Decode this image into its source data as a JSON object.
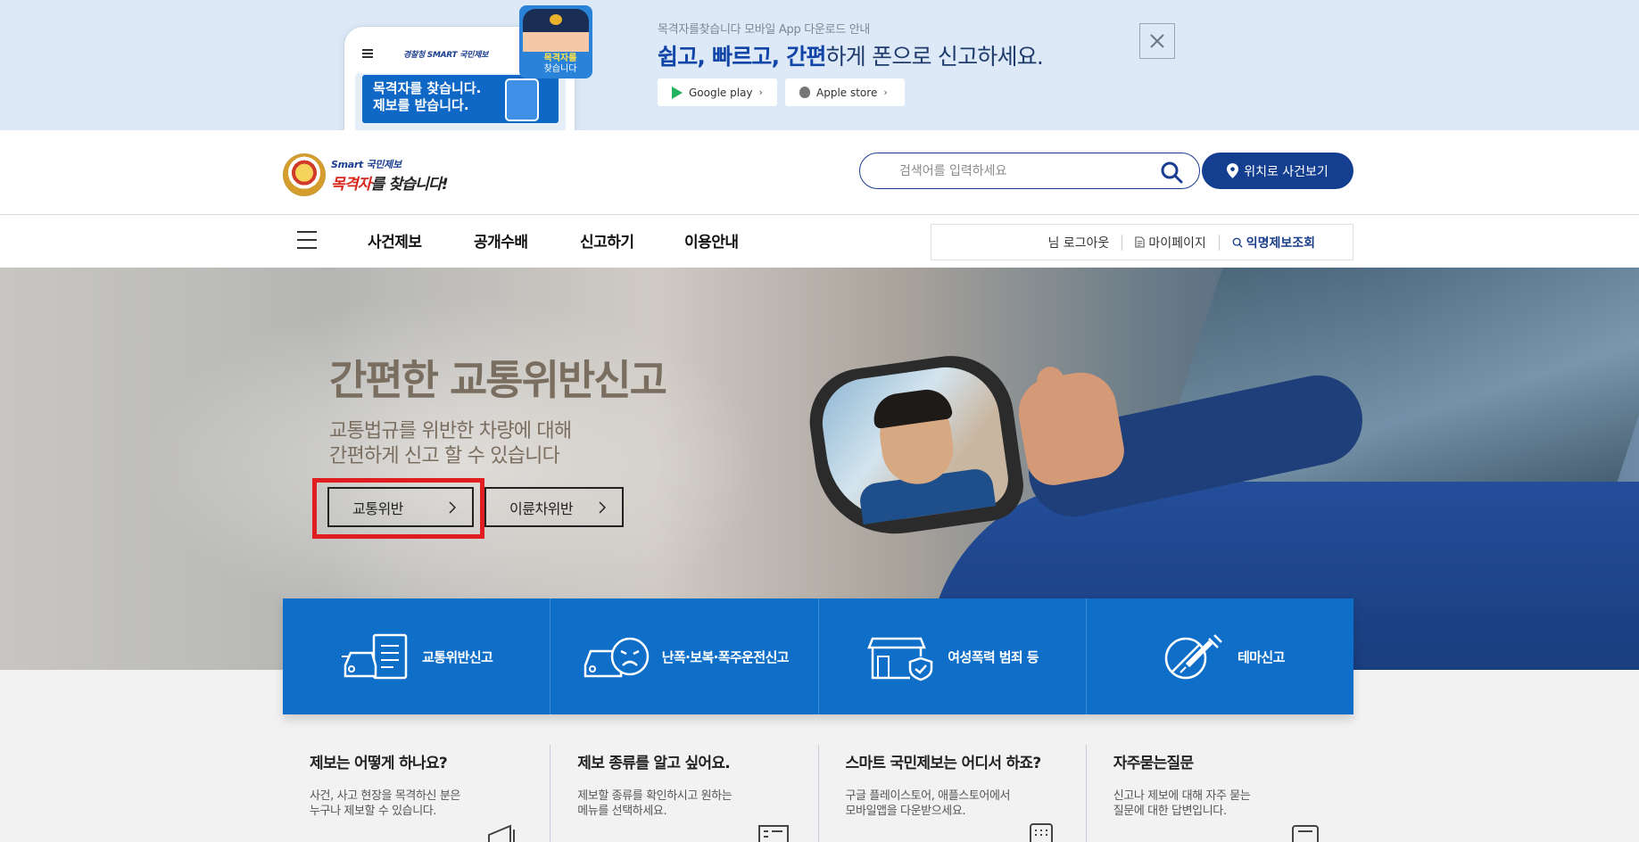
{
  "promo": {
    "phone_logo": "경찰청 SMART 국민제보",
    "phone_card_line1": "목격자를 찾습니다.",
    "phone_card_line2": "제보를 받습니다.",
    "cop_text_line1": "목격자를",
    "cop_text_line2": "찾습니다",
    "small_text": "목격자를찾습니다 모바일 App 다운로드 안내",
    "headline_bold": "쉽고, 빠르고, 간편",
    "headline_rest": "하게 폰으로 신고하세요.",
    "google_label": "Google play",
    "apple_label": "Apple store",
    "close_icon": "close-icon"
  },
  "header": {
    "logo_line1": "Smart 국민제보",
    "logo_line2_red": "목격자",
    "logo_line2_rest": "를 찾습니다!",
    "search_placeholder": "검색어를 입력하세요",
    "location_button": "위치로 사건보기"
  },
  "nav": {
    "items": [
      "사건제보",
      "공개수배",
      "신고하기",
      "이용안내"
    ],
    "util": {
      "logout": "님  로그아웃",
      "mypage": "마이페이지",
      "anon": "익명제보조회"
    }
  },
  "hero": {
    "title": "간편한 교통위반신고",
    "sub_line1": "교통법규를 위반한 차량에 대해",
    "sub_line2": "간편하게 신고 할 수 있습니다",
    "btn_traffic": "교통위반",
    "btn_twowheel": "이륜차위반",
    "accent": "#e01e22"
  },
  "categories": [
    {
      "label": "교통위반신고",
      "icon": "car-document-icon"
    },
    {
      "label": "난폭·보복·폭주운전신고",
      "icon": "angry-car-icon"
    },
    {
      "label": "여성폭력 범죄 등",
      "icon": "store-shield-icon"
    },
    {
      "label": "테마신고",
      "icon": "syringe-ban-icon"
    }
  ],
  "info": [
    {
      "title": "제보는 어떻게 하나요?",
      "desc1": "사건, 사고 현장을 목격하신 분은",
      "desc2": "누구나 제보할 수 있습니다."
    },
    {
      "title": "제보 종류를 알고 싶어요.",
      "desc1": "제보할 종류를 확인하시고 원하는",
      "desc2": "메뉴를 선택하세요."
    },
    {
      "title": "스마트 국민제보는 어디서 하죠?",
      "desc1": "구글 플레이스토어, 애플스토어에서",
      "desc2": "모바일앱을 다운받으세요."
    },
    {
      "title": "자주묻는질문",
      "desc1": "신고나 제보에 대해 자주 묻는",
      "desc2": "질문에 대한 답변입니다."
    }
  ],
  "colors": {
    "brand_blue": "#143f91",
    "category_blue": "#0f6fc8",
    "promo_bg": "#dde9f6"
  }
}
